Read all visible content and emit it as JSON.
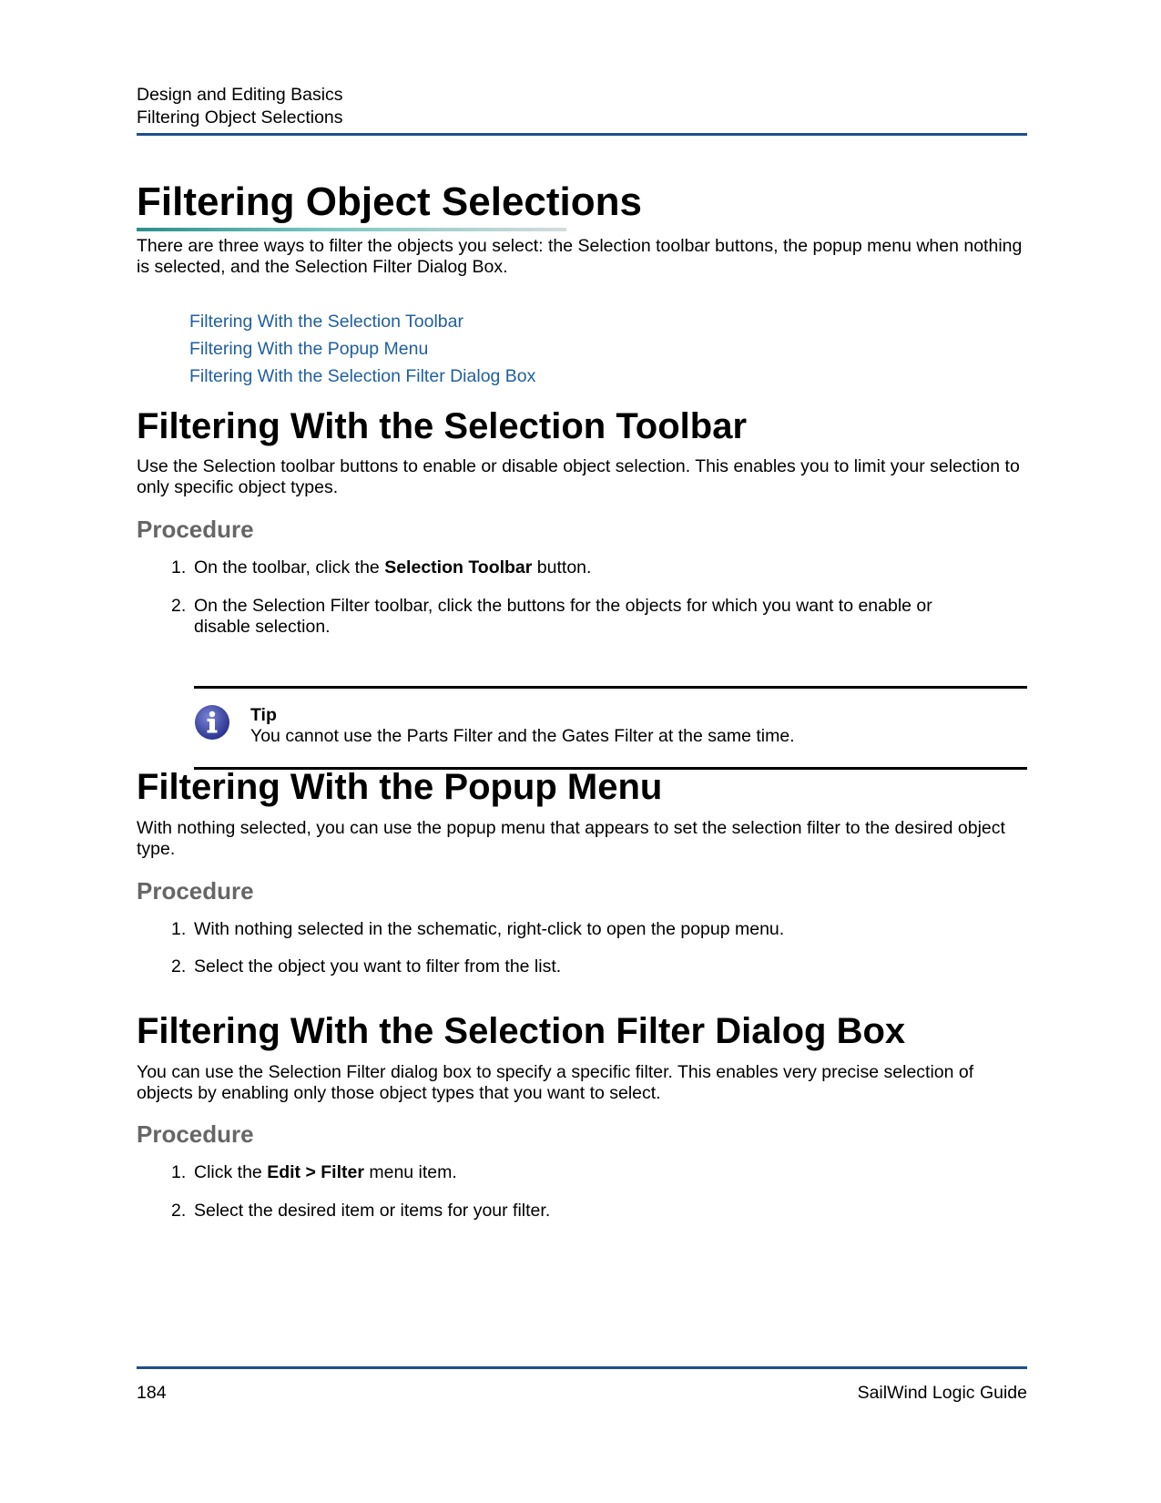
{
  "header": {
    "chapter": "Design and Editing Basics",
    "section": "Filtering Object Selections"
  },
  "title": "Filtering Object Selections",
  "intro": "There are three ways to filter the objects you select: the Selection toolbar buttons, the popup menu when nothing is selected, and the Selection Filter Dialog Box.",
  "toc": [
    "Filtering With the Selection Toolbar",
    "Filtering With the Popup Menu",
    "Filtering With the Selection Filter Dialog Box"
  ],
  "sections": [
    {
      "heading": "Filtering With the Selection Toolbar",
      "body": "Use the Selection toolbar buttons to enable or disable object selection. This enables you to limit your selection to only specific object types.",
      "procedure_label": "Procedure",
      "steps": [
        {
          "num": "1.",
          "pre": "On the toolbar, click the ",
          "bold": "Selection Toolbar",
          "post": " button."
        },
        {
          "num": "2.",
          "text": "On the Selection Filter toolbar, click the buttons for the objects for which you want to enable or disable selection."
        }
      ],
      "tip": {
        "title": "Tip",
        "text": "You cannot use the Parts Filter and the Gates Filter at the same time.",
        "icon": "info-icon"
      }
    },
    {
      "heading": "Filtering With the Popup Menu",
      "body": "With nothing selected, you can use the popup menu that appears to set the selection filter to the desired object type.",
      "procedure_label": "Procedure",
      "steps": [
        {
          "num": "1.",
          "text": "With nothing selected in the schematic, right-click to open the popup menu."
        },
        {
          "num": "2.",
          "text": "Select the object you want to filter from the list."
        }
      ]
    },
    {
      "heading": "Filtering With the Selection Filter Dialog Box",
      "body": "You can use the Selection Filter dialog box to specify a specific filter. This enables very precise selection of objects by enabling only those object types that you want to select.",
      "procedure_label": "Procedure",
      "steps": [
        {
          "num": "1.",
          "pre": "Click the ",
          "bold": "Edit > Filter",
          "post": " menu item."
        },
        {
          "num": "2.",
          "text": "Select the desired item or items for your filter."
        }
      ]
    }
  ],
  "footer": {
    "page_number": "184",
    "doc_title": "SailWind Logic Guide"
  },
  "colors": {
    "rule": "#1f4e8c",
    "link": "#1f5fa0",
    "procedure": "#666666",
    "underline_start": "#2a8f8a"
  }
}
